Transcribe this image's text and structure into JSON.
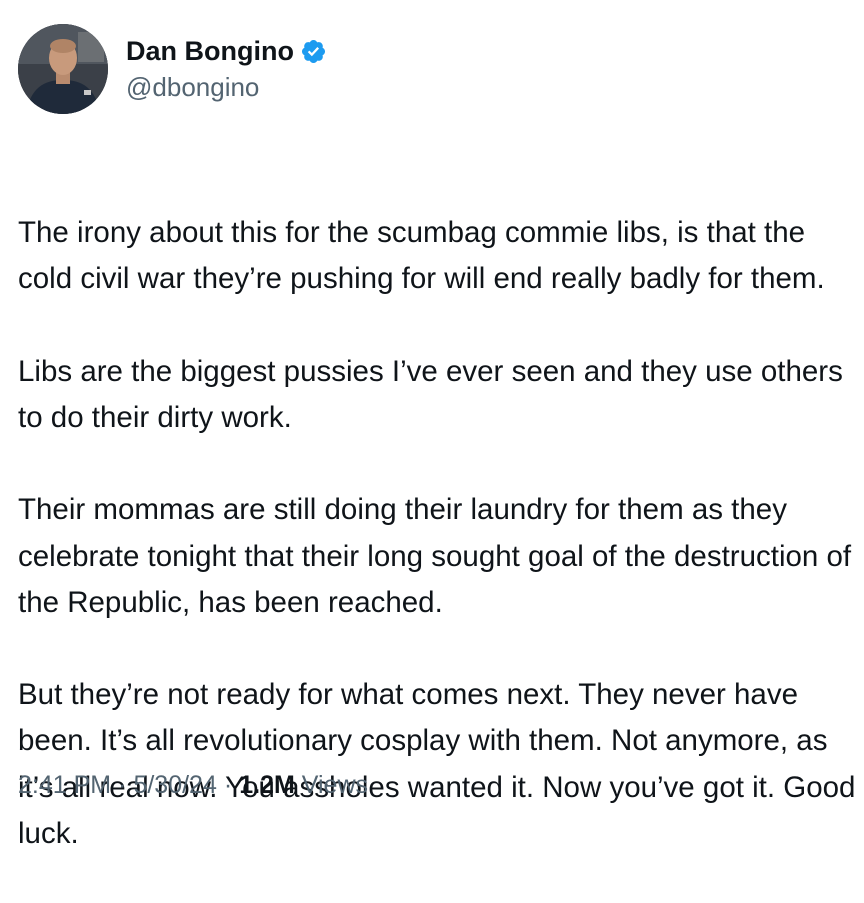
{
  "author": {
    "display_name": "Dan Bongino",
    "handle": "@dbongino",
    "verified": true
  },
  "tweet": {
    "paragraphs": [
      "The irony about this for the scumbag commie libs, is that the cold civil war they’re pushing for will end really badly for them.",
      "Libs are the biggest pussies I’ve ever seen and they use others to do their dirty work.",
      "Their mommas are still doing their laundry for them as they celebrate tonight that their long sought goal of the destruction of the Republic, has been reached.",
      "But they’re not ready for what comes next. They never have been. It’s all revolutionary cosplay with them. Not anymore, as it’s all real now. You assholes wanted it. Now you’ve got it. Good luck."
    ]
  },
  "meta": {
    "time": "2:41 PM",
    "separator": "·",
    "date": "5/30/24",
    "views_count": "1.2M",
    "views_label": "Views"
  },
  "colors": {
    "text": "#0f1419",
    "secondary": "#536471",
    "verified": "#1d9bf0"
  },
  "icons": {
    "verified": "verified-badge-icon",
    "avatar": "profile-avatar"
  }
}
